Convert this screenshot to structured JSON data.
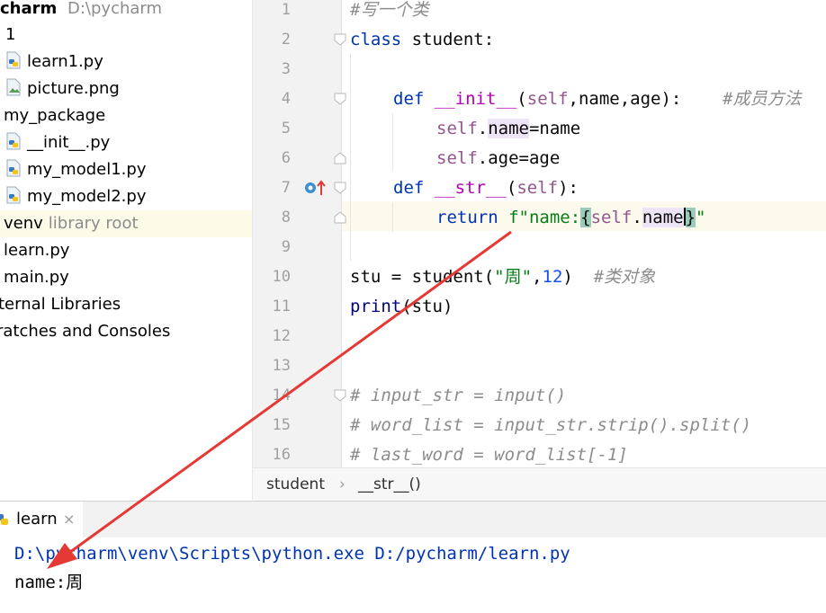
{
  "project": {
    "root_name": "charm",
    "root_path": "D:\\pycharm",
    "items": [
      {
        "label": "1",
        "icon": "folder"
      },
      {
        "label": "learn1.py",
        "icon": "python-file-icon"
      },
      {
        "label": "picture.png",
        "icon": "image-file-icon"
      },
      {
        "label": "my_package",
        "icon": "folder"
      },
      {
        "label": "__init__.py",
        "icon": "python-file-icon"
      },
      {
        "label": "my_model1.py",
        "icon": "python-file-icon"
      },
      {
        "label": "my_model2.py",
        "icon": "python-file-icon"
      },
      {
        "label": "venv",
        "suffix": "library root",
        "icon": "folder",
        "selected": true
      },
      {
        "label": "learn.py",
        "icon": "python-file-icon"
      },
      {
        "label": "main.py",
        "icon": "python-file-icon"
      },
      {
        "label": "ternal Libraries",
        "icon": "library"
      },
      {
        "label": "ratches and Consoles",
        "icon": "scratches"
      }
    ]
  },
  "editor": {
    "line_numbers": [
      "1",
      "2",
      "3",
      "4",
      "5",
      "6",
      "7",
      "8",
      "9",
      "10",
      "11",
      "12",
      "13",
      "14",
      "15",
      "16"
    ],
    "code": {
      "l1": "#写一个类",
      "l2_kw": "class",
      "l2_name": " student:",
      "l4_kw": "def",
      "l4_fn": "__init__",
      "l4_open": "(",
      "l4_self": "self",
      "l4_args": ",name,age):",
      "l4_cmt": "#成员方法",
      "l5_self": "self",
      "l5_dot": ".",
      "l5_attr": "name",
      "l5_rest": "=name",
      "l6_self": "self",
      "l6_rest": ".age=age",
      "l7_kw": "def",
      "l7_fn": "__str__",
      "l7_open": "(",
      "l7_self": "self",
      "l7_close": "):",
      "l8_kw": "return",
      "l8_fstr": " f\"name:",
      "l8_lbrace": "{",
      "l8_self": "self",
      "l8_dot": ".",
      "l8_attr": "name",
      "l8_rbrace": "}",
      "l8_quote": "\"",
      "l10_a": "stu = student(",
      "l10_str": "\"周\"",
      "l10_comma": ",",
      "l10_num": "12",
      "l10_close": ")",
      "l10_cmt": "#类对象",
      "l11_fn": "print",
      "l11_rest": "(stu)",
      "l14": "# input_str = input()",
      "l15": "# word_list = input_str.strip().split()",
      "l16": "# last_word = word_list[-1]"
    },
    "breadcrumb": [
      "student",
      "›",
      "__str__()"
    ]
  },
  "run": {
    "tab_label": "learn",
    "close_glyph": "×",
    "command": "D:\\pycharm\\venv\\Scripts\\python.exe D:/pycharm/learn.py",
    "output": "name:周"
  },
  "colors": {
    "keyword": "#0033b3",
    "self": "#94558d",
    "string": "#067d17",
    "comment": "#8c8c8c",
    "arrow": "#e53935"
  }
}
